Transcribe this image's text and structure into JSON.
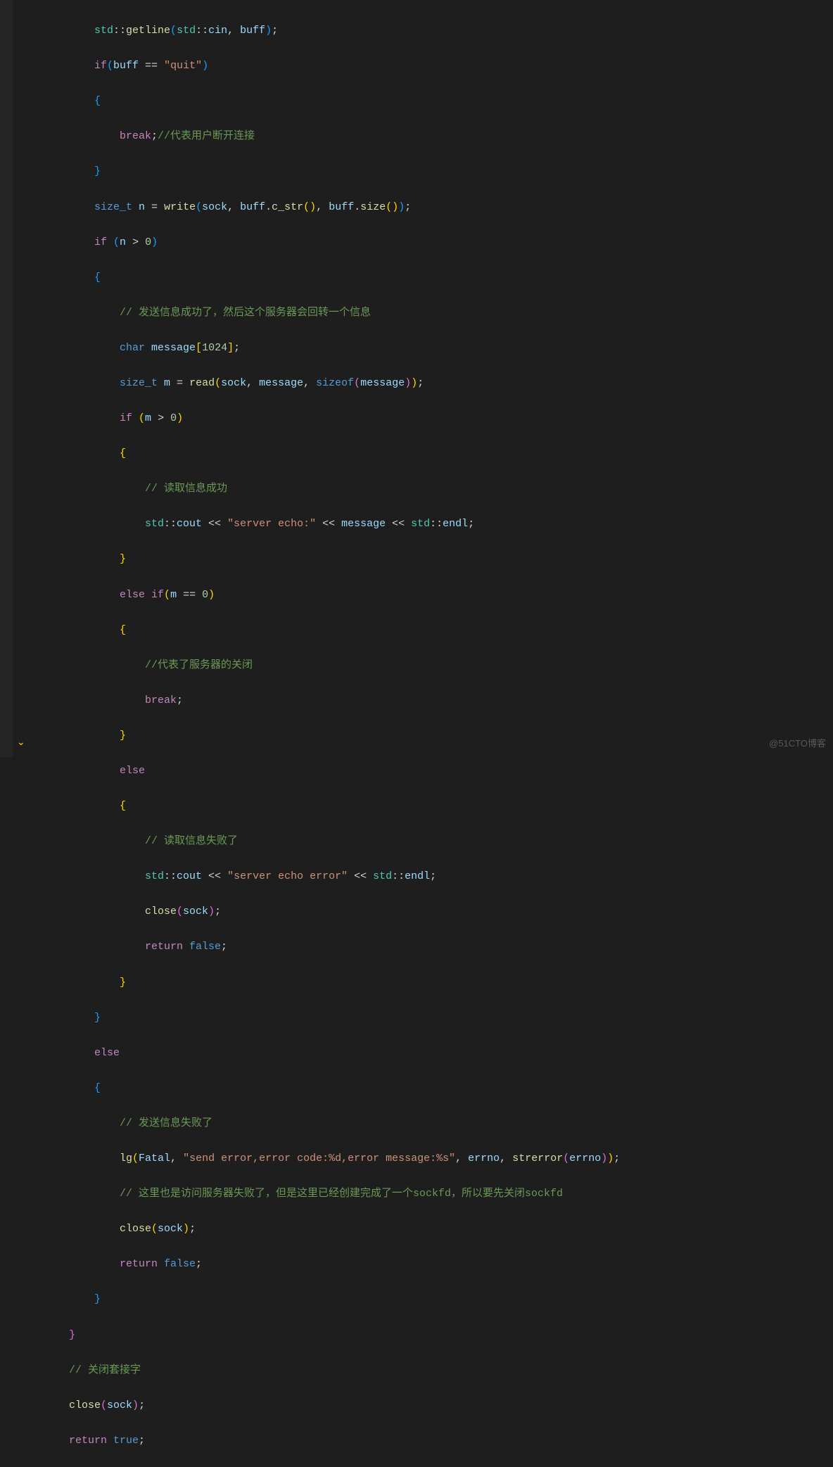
{
  "watermark": "@51CTO博客",
  "code": {
    "l1": {
      "ns": "std",
      "fn": "getline",
      "ns2": "std",
      "var": "cin",
      "var2": "buff"
    },
    "l2": {
      "kw": "if",
      "var": "buff",
      "str": "\"quit\""
    },
    "l4": {
      "kw": "break",
      "cmt": "//代表用户断开连接"
    },
    "l6": {
      "ty": "size_t",
      "var": "n",
      "fn": "write",
      "var2": "sock",
      "var3": "buff",
      "fn2": "c_str",
      "var4": "buff",
      "fn3": "size"
    },
    "l7": {
      "kw": "if",
      "var": "n",
      "num": "0"
    },
    "l9": {
      "cmt": "// 发送信息成功了，然后这个服务器会回转一个信息"
    },
    "l10": {
      "ty": "char",
      "var": "message",
      "num": "1024"
    },
    "l11": {
      "ty": "size_t",
      "var": "m",
      "fn": "read",
      "var2": "sock",
      "var3": "message",
      "kw": "sizeof",
      "var4": "message"
    },
    "l12": {
      "kw": "if",
      "var": "m",
      "num": "0"
    },
    "l14": {
      "cmt": "// 读取信息成功"
    },
    "l15": {
      "ns": "std",
      "var": "cout",
      "str": "\"server echo:\"",
      "var2": "message",
      "ns2": "std",
      "var3": "endl"
    },
    "l17": {
      "kw": "else",
      "kw2": "if",
      "var": "m",
      "num": "0"
    },
    "l19": {
      "cmt": "//代表了服务器的关闭"
    },
    "l20": {
      "kw": "break"
    },
    "l22": {
      "kw": "else"
    },
    "l24": {
      "cmt": "// 读取信息失败了"
    },
    "l25": {
      "ns": "std",
      "var": "cout",
      "str": "\"server echo error\"",
      "ns2": "std",
      "var2": "endl"
    },
    "l26": {
      "fn": "close",
      "var": "sock"
    },
    "l27": {
      "kw": "return",
      "kw2": "false"
    },
    "l30": {
      "kw": "else"
    },
    "l32": {
      "cmt": "// 发送信息失败了"
    },
    "l33": {
      "fn": "lg",
      "var": "Fatal",
      "str": "\"send error,error code:%d,error message:%s\"",
      "var2": "errno",
      "fn2": "strerror",
      "var3": "errno"
    },
    "l34": {
      "cmt": "// 这里也是访问服务器失败了，但是这里已经创建完成了一个sockfd，所以要先关闭sockfd"
    },
    "l35": {
      "fn": "close",
      "var": "sock"
    },
    "l36": {
      "kw": "return",
      "kw2": "false"
    },
    "l39": {
      "cmt": "// 关闭套接字"
    },
    "l40": {
      "fn": "close",
      "var": "sock"
    },
    "l41": {
      "kw": "return",
      "kw2": "true"
    }
  }
}
